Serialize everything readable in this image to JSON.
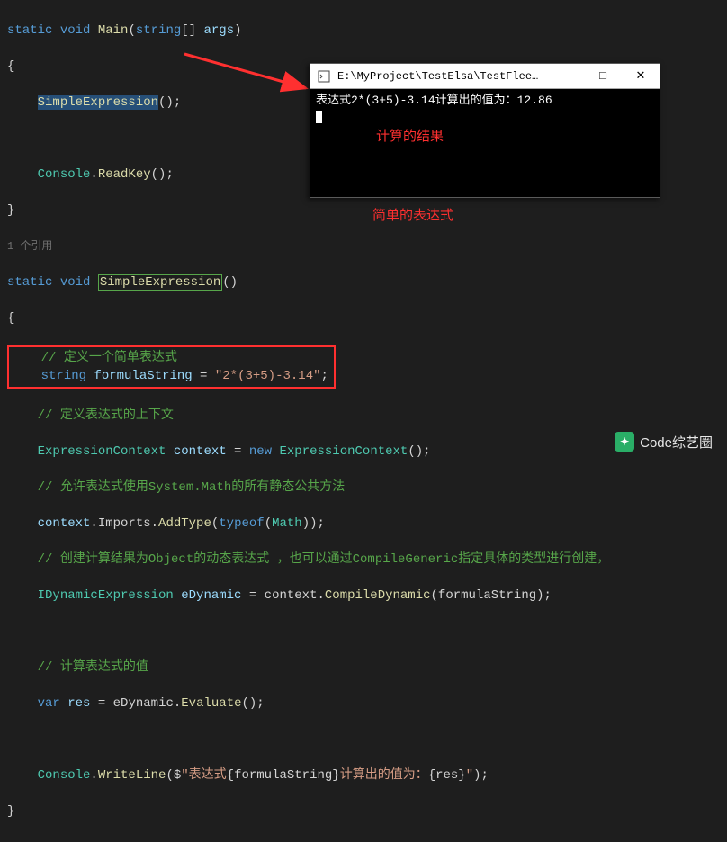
{
  "code": {
    "l1_kw1": "static",
    "l1_kw2": "void",
    "l1_method": "Main",
    "l1_kw3": "string",
    "l1_param": "args",
    "l2": "{",
    "l3_call": "SimpleExpression",
    "l3_rest": "();",
    "l5_type": "Console",
    "l5_method": "ReadKey",
    "l5_rest": "();",
    "l6": "}",
    "ref": "1 个引用",
    "l8_kw1": "static",
    "l8_kw2": "void",
    "l8_method": "SimpleExpression",
    "l8_rest": "()",
    "l9": "{",
    "c1": "// 定义一个简单表达式",
    "l10_kw": "string",
    "l10_var": "formulaString",
    "l10_eq": " = ",
    "l10_str": "\"2*(3+5)-3.14\"",
    "l10_semi": ";",
    "c2": "// 定义表达式的上下文",
    "l12_t": "ExpressionContext",
    "l12_v": "context",
    "l12_eq": " = ",
    "l12_kw": "new",
    "l12_t2": "ExpressionContext",
    "l12_r": "();",
    "c3": "// 允许表达式使用System.Math的所有静态公共方法",
    "l14_v": "context",
    "l14_p": ".Imports.",
    "l14_m": "AddType",
    "l14_a": "(",
    "l14_kw": "typeof",
    "l14_b": "(",
    "l14_t": "Math",
    "l14_c": "));",
    "c4": "// 创建计算结果为Object的动态表达式 ，也可以通过CompileGeneric指定具体的类型进行创建，",
    "l16_t": "IDynamicExpression",
    "l16_v": "eDynamic",
    "l16_eq": " = context.",
    "l16_m": "CompileDynamic",
    "l16_r": "(formulaString);",
    "c5": "// 计算表达式的值",
    "l18_kw": "var",
    "l18_v": "res",
    "l18_eq": " = eDynamic.",
    "l18_m": "Evaluate",
    "l18_r": "();",
    "l20_t": "Console",
    "l20_d": ".",
    "l20_m": "WriteLine",
    "l20_a": "($",
    "l20_s1": "\"表达式",
    "l20_i1": "{formulaString}",
    "l20_s2": "计算出的值为：",
    "l20_i2": "{res}",
    "l20_s3": "\"",
    "l20_b": ");",
    "l21": "}"
  },
  "console": {
    "title": "E:\\MyProject\\TestElsa\\TestFlee\\bin\\D...",
    "output": "表达式2*(3+5)-3.14计算出的值为：12.86",
    "min": "—",
    "max": "□",
    "close": "✕"
  },
  "annotations": {
    "result": "计算的结果",
    "expr": "简单的表达式"
  },
  "watermark": "Code综艺圈"
}
